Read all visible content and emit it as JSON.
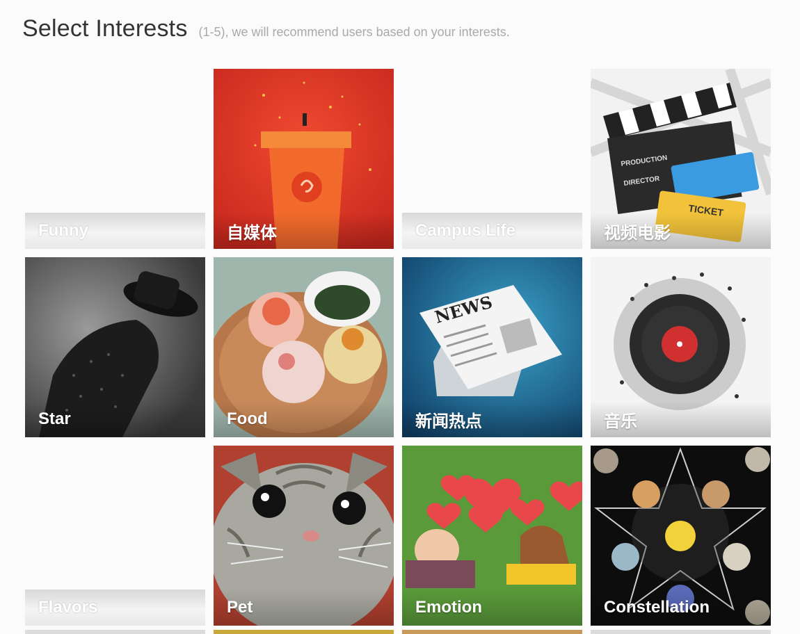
{
  "header": {
    "title": "Select Interests",
    "subtitle": "(1-5), we will recommend users based on your interests."
  },
  "tiles": [
    {
      "label": "Funny",
      "icon": "none"
    },
    {
      "label": "自媒体",
      "icon": "podium-icon"
    },
    {
      "label": "Campus Life",
      "icon": "none"
    },
    {
      "label": "视频电影",
      "icon": "clapperboard-icon"
    },
    {
      "label": "Star",
      "icon": "performer-icon"
    },
    {
      "label": "Food",
      "icon": "sushi-plate-icon"
    },
    {
      "label": "新闻热点",
      "icon": "newspaper-icon"
    },
    {
      "label": "音乐",
      "icon": "vinyl-record-icon"
    },
    {
      "label": "Flavors",
      "icon": "none"
    },
    {
      "label": "Pet",
      "icon": "cat-icon"
    },
    {
      "label": "Emotion",
      "icon": "hearts-couple-icon"
    },
    {
      "label": "Constellation",
      "icon": "star-planets-icon"
    }
  ],
  "art_text": {
    "news": "NEWS",
    "clapper_production": "PRODUCTION",
    "clapper_director": "DIRECTOR",
    "ticket": "TICKET"
  },
  "colors": {
    "podium_bg": "#e23b2a",
    "podium": "#f26a2c",
    "news_bg": "#1e6f9a",
    "heart": "#e8484a",
    "grass": "#5a9a3a",
    "space": "#111111"
  }
}
